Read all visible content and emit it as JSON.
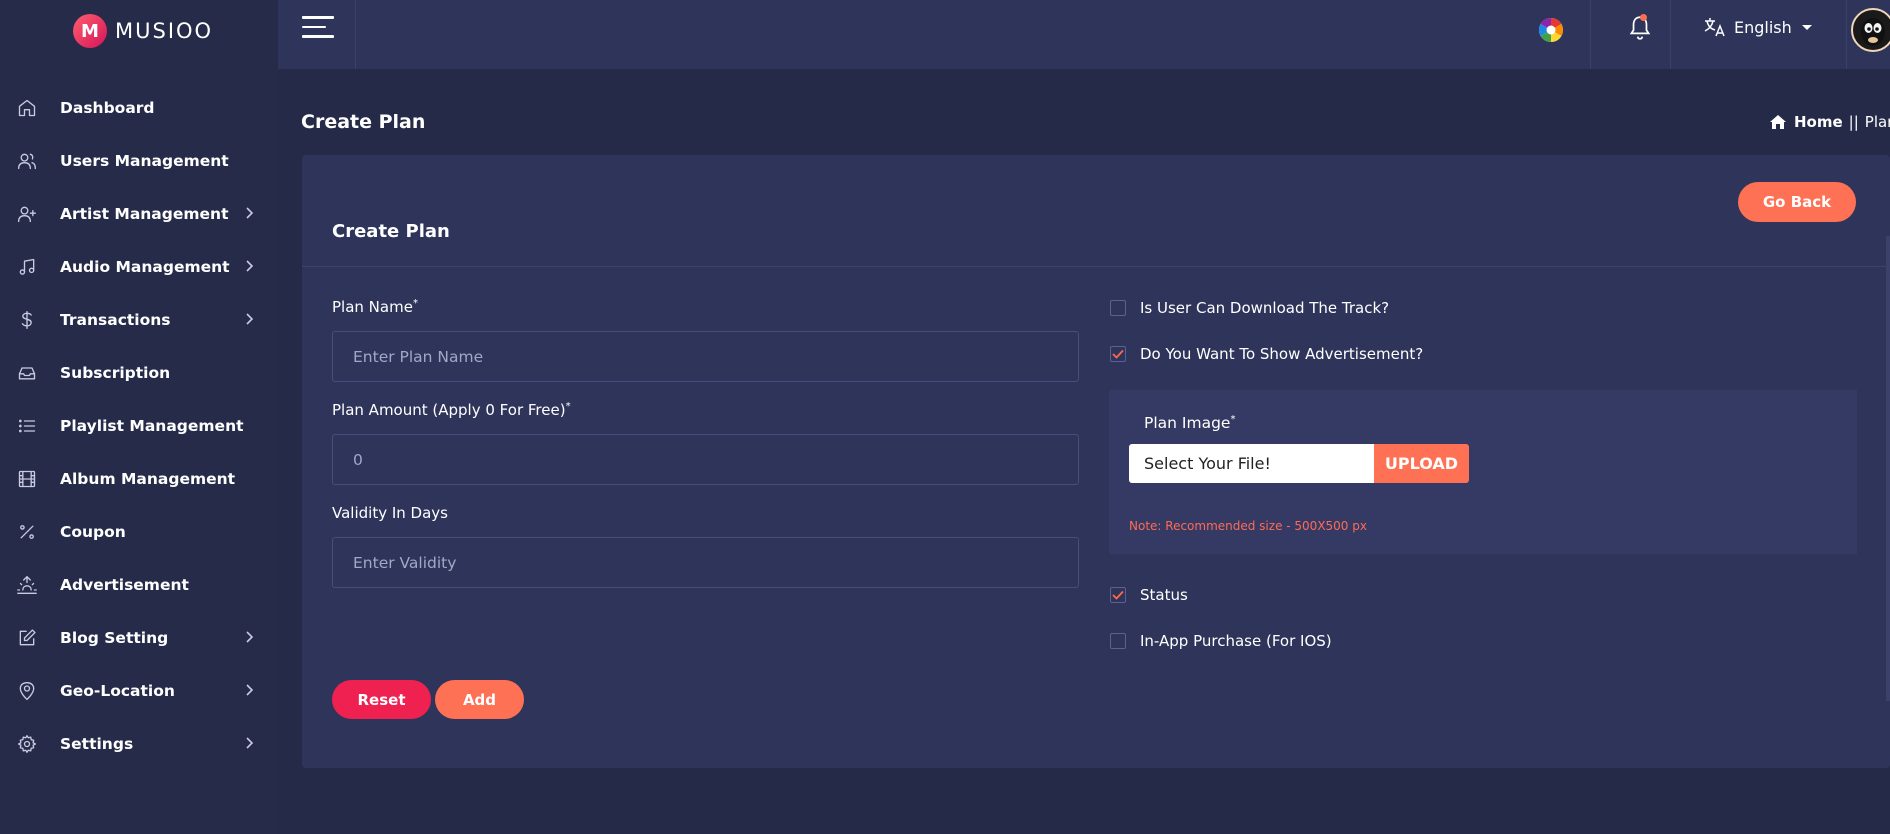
{
  "brand": {
    "name": "MUSIOO",
    "logo_letter": "M"
  },
  "sidebar": {
    "items": [
      {
        "label": "Dashboard",
        "icon": "home-icon",
        "has_children": false
      },
      {
        "label": "Users Management",
        "icon": "users-icon",
        "has_children": false
      },
      {
        "label": "Artist Management",
        "icon": "user-plus-icon",
        "has_children": true
      },
      {
        "label": "Audio Management",
        "icon": "music-note-icon",
        "has_children": true
      },
      {
        "label": "Transactions",
        "icon": "dollar-icon",
        "has_children": true
      },
      {
        "label": "Subscription",
        "icon": "inbox-icon",
        "has_children": false
      },
      {
        "label": "Playlist Management",
        "icon": "list-icon",
        "has_children": false
      },
      {
        "label": "Album Management",
        "icon": "film-icon",
        "has_children": false
      },
      {
        "label": "Coupon",
        "icon": "percent-icon",
        "has_children": false
      },
      {
        "label": "Advertisement",
        "icon": "sunrise-icon",
        "has_children": false
      },
      {
        "label": "Blog Setting",
        "icon": "edit-icon",
        "has_children": true
      },
      {
        "label": "Geo-Location",
        "icon": "map-pin-icon",
        "has_children": true
      },
      {
        "label": "Settings",
        "icon": "gear-icon",
        "has_children": true
      }
    ]
  },
  "topbar": {
    "language": "English",
    "notification_dot": true
  },
  "page": {
    "title": "Create Plan",
    "breadcrumb": {
      "home": "Home",
      "separator": "||",
      "current": "Plan"
    }
  },
  "card": {
    "title": "Create Plan",
    "go_back_label": "Go Back",
    "fields": {
      "plan_name": {
        "label": "Plan Name",
        "required": "*",
        "placeholder": "Enter Plan Name",
        "value": ""
      },
      "plan_amount": {
        "label": "Plan Amount (Apply 0 For Free)",
        "required": "*",
        "placeholder": "0",
        "value": ""
      },
      "validity": {
        "label": "Validity In Days",
        "placeholder": "Enter Validity",
        "value": ""
      }
    },
    "checkboxes": {
      "download": {
        "label": "Is User Can Download The Track?",
        "checked": false
      },
      "advertisement": {
        "label": "Do You Want To Show Advertisement?",
        "checked": true
      },
      "status": {
        "label": "Status",
        "checked": true
      },
      "iap": {
        "label": "In-App Purchase (For IOS)",
        "checked": false
      }
    },
    "image": {
      "label": "Plan Image",
      "required": "*",
      "file_text": "Select Your File!",
      "upload_label": "UPLOAD",
      "note": "Note: Recommended size - 500X500 px"
    },
    "reset_label": "Reset",
    "add_label": "Add"
  },
  "colors": {
    "accent": "#ff7154",
    "danger": "#ee2151",
    "sidebar_bg": "#262b4a",
    "card_bg": "#2f355a",
    "page_bg": "#252a48"
  }
}
